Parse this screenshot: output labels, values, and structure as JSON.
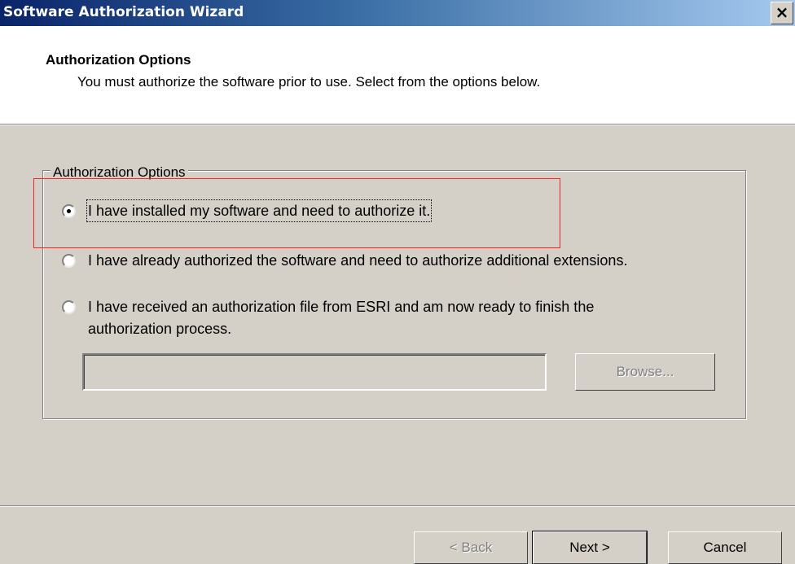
{
  "window": {
    "title": "Software Authorization Wizard",
    "close_label": "×"
  },
  "header": {
    "title": "Authorization Options",
    "subtitle": "You must authorize the software prior to use. Select from the options below."
  },
  "group": {
    "legend": "Authorization Options",
    "options": [
      {
        "label": "I have installed my software and need to authorize it.",
        "selected": true
      },
      {
        "label": "I have already authorized the software and need to authorize additional extensions.",
        "selected": false
      },
      {
        "label_line1": "I have received an authorization file from ESRI and am now ready to finish the",
        "label_line2": "authorization process.",
        "selected": false
      }
    ],
    "file_path_value": "",
    "browse_label": "Browse..."
  },
  "buttons": {
    "back_label": "< Back",
    "next_label": "Next >",
    "cancel_label": "Cancel"
  },
  "colors": {
    "highlight": "#ff2020",
    "face": "#d4d0c8",
    "title_gradient_start": "#0a246a"
  }
}
